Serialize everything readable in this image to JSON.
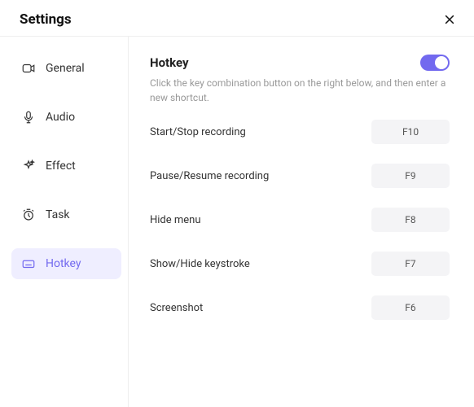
{
  "title": "Settings",
  "sidebar": {
    "items": [
      {
        "label": "General",
        "icon": "camera-icon"
      },
      {
        "label": "Audio",
        "icon": "mic-icon"
      },
      {
        "label": "Effect",
        "icon": "sparkle-icon"
      },
      {
        "label": "Task",
        "icon": "clock-icon"
      },
      {
        "label": "Hotkey",
        "icon": "keyboard-icon"
      }
    ]
  },
  "main": {
    "heading": "Hotkey",
    "description": "Click the key combination button on the right below, and then enter a new shortcut.",
    "toggle_on": true,
    "rows": [
      {
        "label": "Start/Stop recording",
        "key": "F10"
      },
      {
        "label": "Pause/Resume recording",
        "key": "F9"
      },
      {
        "label": "Hide menu",
        "key": "F8"
      },
      {
        "label": "Show/Hide keystroke",
        "key": "F7"
      },
      {
        "label": "Screenshot",
        "key": "F6"
      }
    ]
  }
}
